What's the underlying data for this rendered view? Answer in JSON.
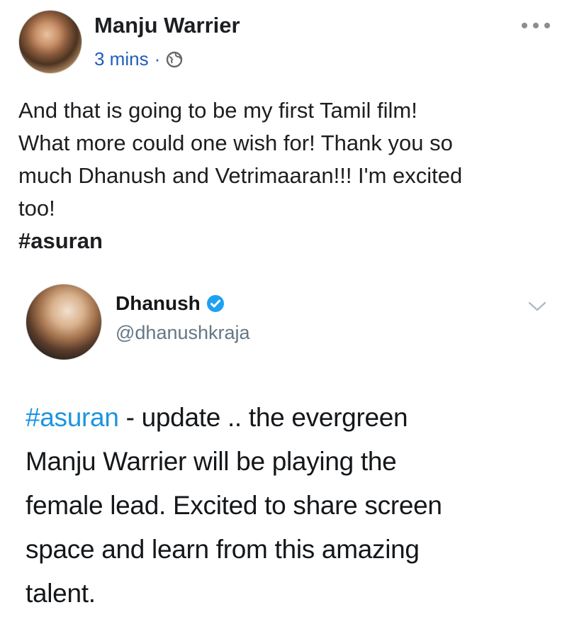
{
  "post": {
    "author": "Manju Warrier",
    "time": "3 mins",
    "separator": "·",
    "privacy_icon": "globe-icon",
    "more_icon": "more-options-icon",
    "text_lines": [
      "And that is going to be my first Tamil film!",
      "What more could one wish for! Thank you so",
      "much Dhanush and Vetrimaaran!!! I'm excited",
      "too!"
    ],
    "hashtag": "#asuran"
  },
  "tweet": {
    "name": "Dhanush",
    "verified_icon": "verified-badge-icon",
    "handle": "@dhanushkraja",
    "menu_icon": "chevron-down-icon",
    "hashtag": "#asuran",
    "text_first_line_rest": " - update .. the evergreen",
    "text_lines": [
      "Manju Warrier will be playing the",
      "female lead. Excited to share screen",
      "space and learn from this amazing",
      "talent."
    ],
    "colors": {
      "hashtag": "#1b95e0",
      "verified": "#1da1f2",
      "fb_link": "#1e5dbb"
    }
  }
}
